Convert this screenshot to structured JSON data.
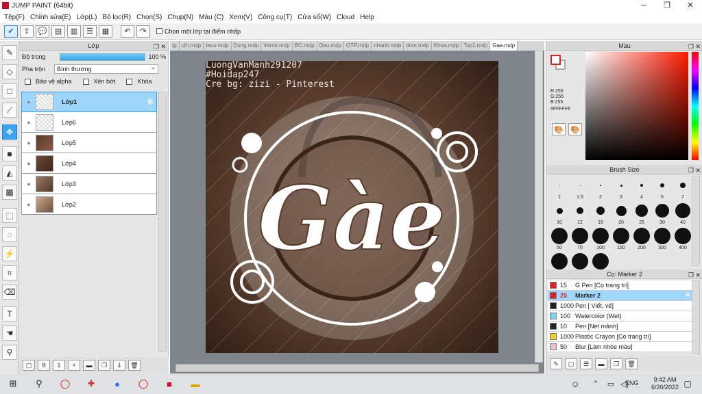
{
  "window": {
    "title": "JUMP PAINT (64bit)",
    "min": "─",
    "max": "❐",
    "close": "✕"
  },
  "menu": [
    "Tệp(F)",
    "Chỉnh sửa(E)",
    "Lớp(L)",
    "Bộ lọc(R)",
    "Chọn(S)",
    "Chụp(N)",
    "Màu (C)",
    "Xem(V)",
    "Công cụ(T)",
    "Cửa sổ(W)",
    "Cloud",
    "Help"
  ],
  "toolbar": {
    "checkbox_label": "Chọn một lớp tại điểm nhấp"
  },
  "layer_panel": {
    "title": "Lớp",
    "opacity_label": "Độ trong",
    "opacity_value": "100 %",
    "opacity_percent": 100,
    "blend_label": "Pha trộn",
    "blend_value": "Bình thường",
    "protect_alpha": "Bảo vệ alpha",
    "clipping": "Xén bớt",
    "lock": "Khóa",
    "layers": [
      {
        "name": "Lớp1",
        "selected": true
      },
      {
        "name": "Lớp6",
        "selected": false
      },
      {
        "name": "Lớp5",
        "selected": false
      },
      {
        "name": "Lớp4",
        "selected": false
      },
      {
        "name": "Lớp3",
        "selected": false
      },
      {
        "name": "Lớp2",
        "selected": false
      }
    ]
  },
  "tabs": [
    "tp",
    "cth.mdp",
    "Ieuu.mdp",
    "Dung.mdp",
    "Vsmb.mdp",
    "BC.mdp",
    "Dau.mdp",
    "OTP.mdp",
    "nhanh.mdp",
    "dom.mdp",
    "Khoa.mdp",
    "Top1.mdp",
    "Gae.mdp"
  ],
  "active_tab": "Gae.mdp",
  "canvas": {
    "watermark_lines": [
      "LuongVanManh291207",
      "#Hoidap247",
      "Cre bg: zizi - Pinterest"
    ],
    "art_text": "Gàe"
  },
  "color_panel": {
    "title": "Màu",
    "r": "R:255",
    "g": "G:255",
    "b": "B:255",
    "hex": "#FFFFFF",
    "foreground": "#e02020",
    "background": "#ffffff"
  },
  "brush_panel": {
    "title": "Brush Size",
    "sizes": [
      "1",
      "1.5",
      "2",
      "3",
      "4",
      "5",
      "7",
      "10",
      "12",
      "15",
      "20",
      "25",
      "30",
      "40",
      "50",
      "70",
      "100",
      "150",
      "200",
      "300",
      "400",
      "",
      "",
      ""
    ]
  },
  "material_panel": {
    "title": "Cọ: Marker 2",
    "items": [
      {
        "num": "15",
        "name": "G Pen [Cọ trang trí]",
        "color": "#e02020"
      },
      {
        "num": "25",
        "name": "Marker 2",
        "color": "#e02020"
      },
      {
        "num": "1000",
        "name": "Pen [ Viết, vẽ]",
        "color": "#222222"
      },
      {
        "num": "100",
        "name": "Watercolor (Wet)",
        "color": "#7fd3f5"
      },
      {
        "num": "10",
        "name": "Pen [Nét mảnh]",
        "color": "#222222"
      },
      {
        "num": "1000",
        "name": "Plastic Crayon [Cọ trang trí]",
        "color": "#f0d020"
      },
      {
        "num": "50",
        "name": "Blur [Làm nhòe màu]",
        "color": "#f4b8d8"
      }
    ]
  },
  "taskbar": {
    "lang": "ENG",
    "time": "9:42 AM",
    "date": "6/20/2022"
  }
}
